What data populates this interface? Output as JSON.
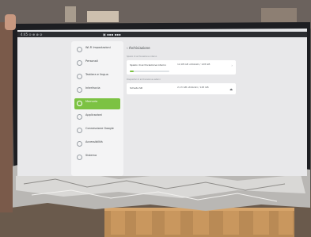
{
  "status_bar": {
    "left_text": "4:45 ⊙ ⊕ ⊗ ⊘",
    "center_text": "▣  ▪▪▪ ▪▪▪"
  },
  "sidebar": {
    "items": [
      {
        "label": "Wi-Fi Impostazioni",
        "sub": "",
        "icon": "wifi-icon"
      },
      {
        "label": "Personali",
        "sub": "",
        "icon": "person-icon"
      },
      {
        "label": "Tastiera e lingua",
        "sub": "",
        "icon": "keyboard-icon"
      },
      {
        "label": "Interfaccia",
        "sub": "",
        "icon": "display-icon"
      },
      {
        "label": "Memoria",
        "sub": "",
        "icon": "storage-icon"
      },
      {
        "label": "Applicazioni",
        "sub": "",
        "icon": "apps-icon"
      },
      {
        "label": "Connessione Google",
        "sub": "",
        "icon": "google-icon"
      },
      {
        "label": "Accessibilità",
        "sub": "",
        "icon": "accessibility-icon"
      },
      {
        "label": "Sistema",
        "sub": "",
        "icon": "system-icon"
      }
    ],
    "active_index": 4
  },
  "main": {
    "title": "‹  Archiviazione",
    "internal_section": "Spazio di archiviazione interno",
    "internal_card": {
      "title": "Spazio di archiviazione interno",
      "value": "12,98 GB utilizzati / 128 GB",
      "used_fraction": 0.1
    },
    "external_section": "Dispositivi di archiviazione esterni",
    "external_card": {
      "title": "Scheda SD",
      "value": "2,13 GB utilizzati / 128 GB"
    }
  },
  "colors": {
    "accent": "#7cc243"
  }
}
